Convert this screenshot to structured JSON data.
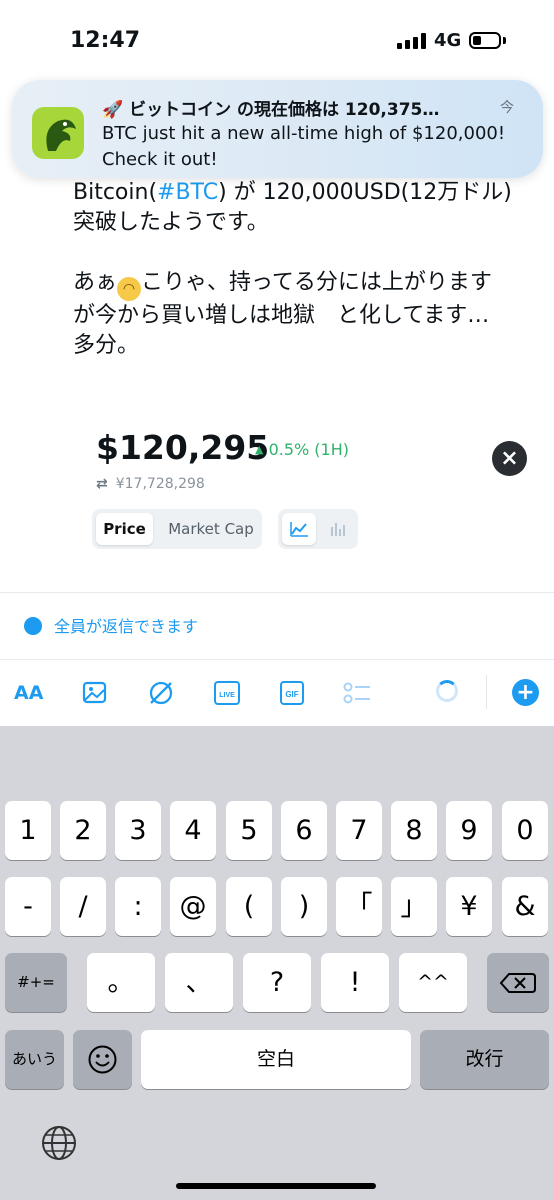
{
  "status_bar": {
    "time": "12:47",
    "network": "4G"
  },
  "notification": {
    "title": "🚀 ビットコイン の現在価格は 120,375…",
    "time": "今",
    "body": "BTC just hit a new all-time high of $120,000! Check it out!"
  },
  "post": {
    "line1_prefix": "Bitcoin(",
    "line1_hashtag": "#BTC",
    "line1_suffix": ") が 120,000USD(12万ドル)",
    "line2": "突破したようです。",
    "line3_a": "あぁ",
    "line3_b": "こりゃ、持ってる分には上がります",
    "line4": "が今から買い増しは地獄　と化してます…",
    "line5": "多分。"
  },
  "price_card": {
    "price": "$120,295",
    "change": "0.5% (1H)",
    "yen": "¥17,728,298",
    "tab_price": "Price",
    "tab_market_cap": "Market Cap"
  },
  "reply_setting": "全員が返信できます",
  "toolbar": {
    "text_size": "AA"
  },
  "keyboard": {
    "row1": [
      "1",
      "2",
      "3",
      "4",
      "5",
      "6",
      "7",
      "8",
      "9",
      "0"
    ],
    "row2": [
      "-",
      "/",
      ":",
      "@",
      "(",
      ")",
      "「",
      "」",
      "¥",
      "&"
    ],
    "row3_left": "#+=",
    "row3": [
      "。",
      "、",
      "?",
      "!",
      "^^"
    ],
    "kana": "あいう",
    "space": "空白",
    "return": "改行"
  },
  "colors": {
    "accent": "#1d9bf0",
    "positive": "#2fb36b",
    "keyboard_bg": "#d3d5da"
  }
}
